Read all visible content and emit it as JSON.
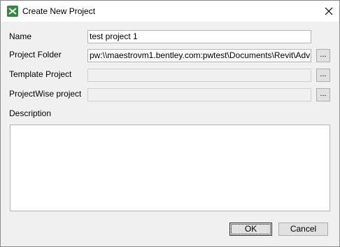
{
  "window": {
    "title": "Create New Project",
    "icon": "app-logo-icon",
    "close_icon": "close-icon"
  },
  "form": {
    "name_label": "Name",
    "name_value": "test project 1",
    "folder_label": "Project Folder",
    "folder_value": "pw:\\\\maestrovm1.bentley.com:pwtest\\Documents\\Revit\\Adv",
    "template_label": "Template Project",
    "template_value": "",
    "pw_label": "ProjectWise project",
    "pw_value": "",
    "browse_label": "...",
    "description_label": "Description",
    "description_value": ""
  },
  "buttons": {
    "ok": "OK",
    "cancel": "Cancel"
  },
  "colors": {
    "icon_green": "#2e8b3a",
    "focus_border": "#333333"
  }
}
